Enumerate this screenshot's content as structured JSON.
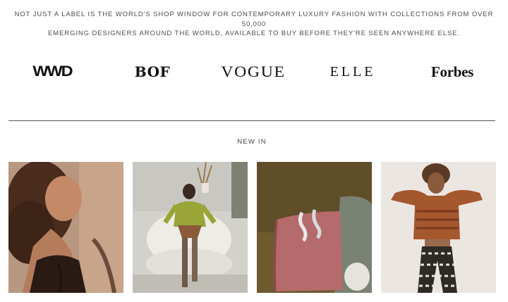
{
  "intro": {
    "line1": "NOT JUST A LABEL IS THE WORLD'S SHOP WINDOW FOR CONTEMPORARY LUXURY FASHION WITH COLLECTIONS FROM OVER 50,000",
    "line2": "EMERGING DESIGNERS AROUND THE WORLD, AVAILABLE TO BUY BEFORE THEY'RE SEEN ANYWHERE ELSE."
  },
  "press": {
    "logos": [
      {
        "name": "WWD",
        "text": "WWD"
      },
      {
        "name": "BoF",
        "text": "BOF"
      },
      {
        "name": "Vogue",
        "text": "VOGUE"
      },
      {
        "name": "Elle",
        "text": "ELLE"
      },
      {
        "name": "Forbes",
        "text": "Forbes"
      }
    ]
  },
  "new_in": {
    "title": "NEW IN",
    "products": [
      {
        "image": "woman-curly-hair-black-lingerie"
      },
      {
        "image": "woman-green-cardigan-sitting-white-chair"
      },
      {
        "image": "silver-earrings-on-pink-block"
      },
      {
        "image": "woman-rust-knit-top-patterned-trousers"
      }
    ]
  },
  "colors": {
    "text": "#4a4a4a",
    "divider": "#555555",
    "background": "#ffffff"
  }
}
